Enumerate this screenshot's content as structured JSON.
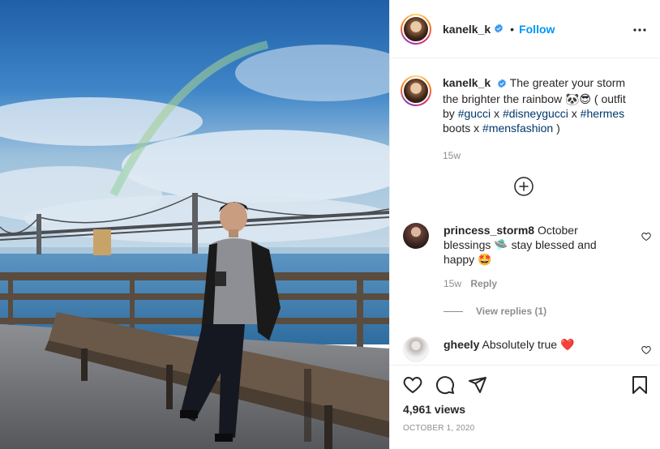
{
  "post": {
    "username": "kanelk_k",
    "follow_label": "Follow",
    "separator": "•"
  },
  "caption": {
    "username": "kanelk_k",
    "part1": "The greater your storm the brighter the rainbow",
    "emoji": "🐼😎",
    "part2": "( outfit by",
    "tag1": "#gucci",
    "x1": "x",
    "tag2": "#disneygucci",
    "x2": "x",
    "tag3": "#hermes",
    "part3": "boots x",
    "tag4": "#mensfashion",
    "part4": ")",
    "timestamp": "15w"
  },
  "comments": [
    {
      "username": "princess_storm8",
      "text": "October blessings",
      "emoji1": "🛸",
      "text2": "stay blessed and happy",
      "emoji2": "🤩",
      "timestamp": "15w",
      "reply_label": "Reply",
      "view_replies": "View replies (1)"
    },
    {
      "username": "gheely",
      "text": "Absolutely true",
      "emoji": "❤️"
    }
  ],
  "footer": {
    "views": "4,961 views",
    "date": "OCTOBER 1, 2020"
  },
  "icons": {
    "verified": "verified-badge-icon",
    "more": "more-options-icon",
    "load_more": "plus-circle-icon",
    "like": "heart-icon",
    "comment": "comment-bubble-icon",
    "share": "paper-plane-icon",
    "save": "bookmark-icon"
  },
  "colors": {
    "link": "#0095f6",
    "hashtag": "#00376b",
    "muted": "#8e8e8e",
    "heart": "#ed4956"
  }
}
